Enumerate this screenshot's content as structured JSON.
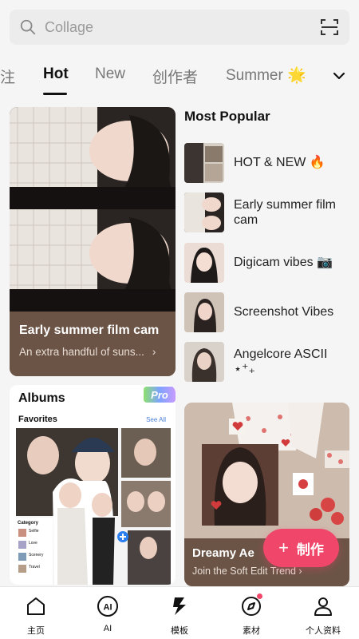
{
  "search": {
    "placeholder": "Collage"
  },
  "tabs": [
    {
      "label": "注"
    },
    {
      "label": "Hot"
    },
    {
      "label": "New"
    },
    {
      "label": "创作者"
    },
    {
      "label": "Summer 🌟"
    }
  ],
  "featured": {
    "title": "Early summer film cam",
    "subtitle": "An extra handful of suns...",
    "chevron": "›"
  },
  "most_popular": {
    "title": "Most Popular",
    "items": [
      {
        "label": "HOT & NEW 🔥"
      },
      {
        "label": "Early summer film cam"
      },
      {
        "label": "Digicam vibes 📷"
      },
      {
        "label": "Screenshot Vibes"
      },
      {
        "label": "Angelcore ASCII ⋆⁺₊"
      }
    ]
  },
  "albums": {
    "title": "Albums",
    "badge": "Pro",
    "section": "Favorites",
    "see_all": "See All",
    "categories_title": "Category",
    "categories": [
      "Selfie",
      "Love",
      "Scenery",
      "Travel"
    ]
  },
  "dreamy": {
    "title": "Dreamy Ae",
    "subtitle": "Join the Soft Edit Trend ›"
  },
  "fab": {
    "plus": "+",
    "label": "制作"
  },
  "nav": [
    {
      "label": "主页"
    },
    {
      "label": "AI"
    },
    {
      "label": "模板"
    },
    {
      "label": "素材"
    },
    {
      "label": "个人资料"
    }
  ],
  "colors": {
    "accent": "#f0466a",
    "caption_bg": "#6b5446",
    "link": "#4a7fd8"
  }
}
